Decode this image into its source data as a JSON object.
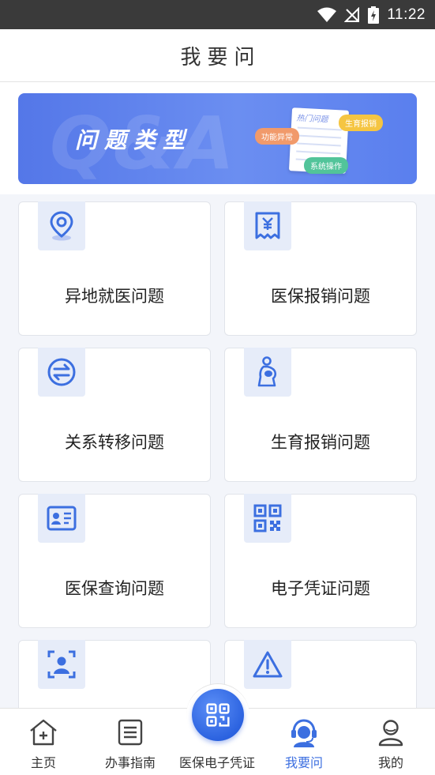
{
  "status_bar": {
    "time": "11:22",
    "icons": [
      "wifi-icon",
      "no-signal-icon",
      "battery-charging-icon"
    ]
  },
  "header": {
    "title": "我要问"
  },
  "banner": {
    "bg_text": "Q&A",
    "title": "问题类型",
    "doc_heading": "热门问题",
    "tags": {
      "func": "功能异常",
      "birth": "生育报销",
      "sys": "系统操作"
    }
  },
  "cards": [
    {
      "label": "异地就医问题",
      "icon": "location-pin-icon"
    },
    {
      "label": "医保报销问题",
      "icon": "receipt-yuan-icon"
    },
    {
      "label": "关系转移问题",
      "icon": "transfer-icon"
    },
    {
      "label": "生育报销问题",
      "icon": "pregnant-woman-icon"
    },
    {
      "label": "医保查询问题",
      "icon": "id-card-icon"
    },
    {
      "label": "电子凭证问题",
      "icon": "qr-code-icon"
    },
    {
      "label": "",
      "icon": "face-scan-icon"
    },
    {
      "label": "",
      "icon": "warning-icon"
    }
  ],
  "tabbar": {
    "active": "我要问",
    "tabs": [
      {
        "label": "主页",
        "icon": "home-icon"
      },
      {
        "label": "办事指南",
        "icon": "guide-list-icon"
      },
      {
        "label": "医保电子凭证",
        "icon": "qr-code-icon"
      },
      {
        "label": "我要问",
        "icon": "customer-service-icon"
      },
      {
        "label": "我的",
        "icon": "user-icon"
      }
    ]
  },
  "colors": {
    "accent": "#3c6fe0",
    "banner": "#5a7fee",
    "icon_bg": "#e6ecf9"
  }
}
